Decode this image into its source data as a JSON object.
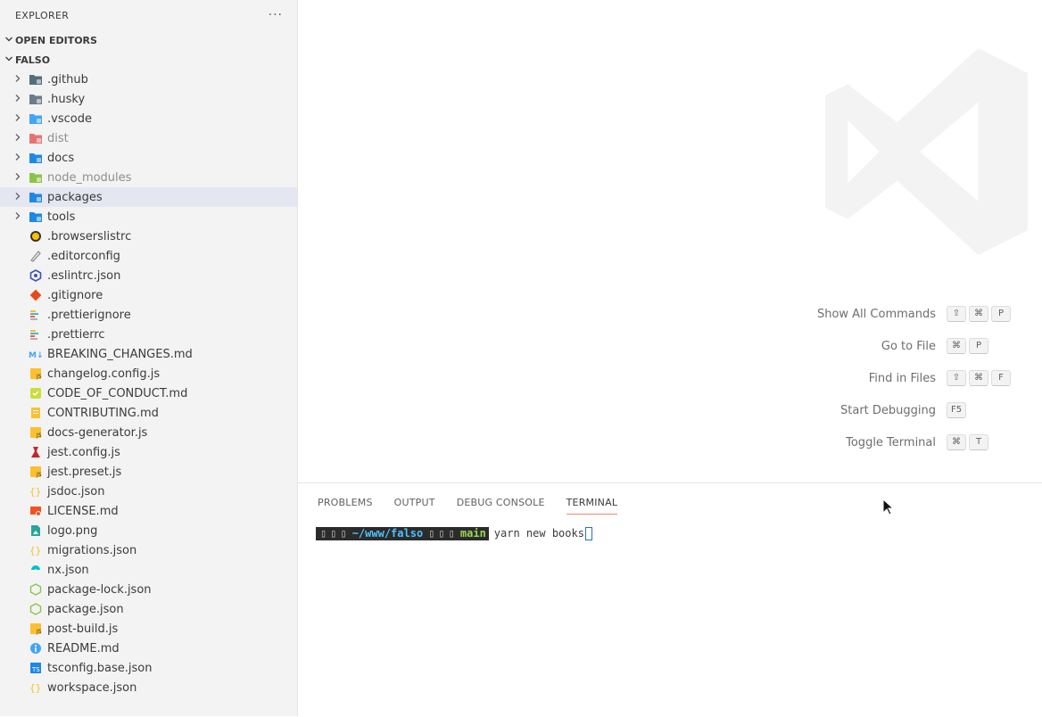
{
  "sidebar": {
    "title": "EXPLORER",
    "more_glyph": "···",
    "sections": {
      "open_editors": "OPEN EDITORS",
      "project": "FALSO"
    },
    "folders": [
      {
        "label": ".github",
        "icon": "folder-github-icon",
        "color": "#546e7a"
      },
      {
        "label": ".husky",
        "icon": "folder-husky-icon",
        "color": "#6b7b8a"
      },
      {
        "label": ".vscode",
        "icon": "folder-vscode-icon",
        "color": "#42a5f5"
      },
      {
        "label": "dist",
        "icon": "folder-dist-icon",
        "color": "#e57373"
      },
      {
        "label": "docs",
        "icon": "folder-docs-icon",
        "color": "#1e88e5"
      },
      {
        "label": "node_modules",
        "icon": "folder-node-icon",
        "color": "#8bc34a"
      },
      {
        "label": "packages",
        "icon": "folder-packages-icon",
        "color": "#1e88e5"
      },
      {
        "label": "tools",
        "icon": "folder-tools-icon",
        "color": "#1e88e5"
      }
    ],
    "files": [
      {
        "label": ".browserslistrc",
        "icon": "browserslist-icon",
        "color": "#f9c000"
      },
      {
        "label": ".editorconfig",
        "icon": "editorconfig-icon",
        "color": "#8a8a8a"
      },
      {
        "label": ".eslintrc.json",
        "icon": "eslint-icon",
        "color": "#3f51b5"
      },
      {
        "label": ".gitignore",
        "icon": "git-icon",
        "color": "#e64a19"
      },
      {
        "label": ".prettierignore",
        "icon": "prettier-icon",
        "color": "#b0b0b0"
      },
      {
        "label": ".prettierrc",
        "icon": "prettier-icon",
        "color": "#b0b0b0"
      },
      {
        "label": "BREAKING_CHANGES.md",
        "icon": "markdown-icon",
        "color": "#42a5f5"
      },
      {
        "label": "changelog.config.js",
        "icon": "javascript-icon",
        "color": "#fbc02d"
      },
      {
        "label": "CODE_OF_CONDUCT.md",
        "icon": "conduct-icon",
        "color": "#cddc39"
      },
      {
        "label": "CONTRIBUTING.md",
        "icon": "contributing-icon",
        "color": "#fbc02d"
      },
      {
        "label": "docs-generator.js",
        "icon": "javascript-icon",
        "color": "#fbc02d"
      },
      {
        "label": "jest.config.js",
        "icon": "jest-icon",
        "color": "#c62828"
      },
      {
        "label": "jest.preset.js",
        "icon": "javascript-icon",
        "color": "#fbc02d"
      },
      {
        "label": "jsdoc.json",
        "icon": "json-icon",
        "color": "#fbc02d"
      },
      {
        "label": "LICENSE.md",
        "icon": "license-icon",
        "color": "#f4511e"
      },
      {
        "label": "logo.png",
        "icon": "image-icon",
        "color": "#26a69a"
      },
      {
        "label": "migrations.json",
        "icon": "json-icon",
        "color": "#fbc02d"
      },
      {
        "label": "nx.json",
        "icon": "nx-icon",
        "color": "#00bcd4"
      },
      {
        "label": "package-lock.json",
        "icon": "nodejs-icon",
        "color": "#8bc34a"
      },
      {
        "label": "package.json",
        "icon": "nodejs-icon",
        "color": "#8bc34a"
      },
      {
        "label": "post-build.js",
        "icon": "javascript-icon",
        "color": "#fbc02d"
      },
      {
        "label": "README.md",
        "icon": "info-icon",
        "color": "#42a5f5"
      },
      {
        "label": "tsconfig.base.json",
        "icon": "tsconfig-icon",
        "color": "#1e88e5"
      },
      {
        "label": "workspace.json",
        "icon": "json-icon",
        "color": "#fbc02d"
      }
    ]
  },
  "editor": {
    "commands": [
      {
        "name": "Show All Commands",
        "keys": [
          "⇧",
          "⌘",
          "P"
        ]
      },
      {
        "name": "Go to File",
        "keys": [
          "⌘",
          "P"
        ]
      },
      {
        "name": "Find in Files",
        "keys": [
          "⇧",
          "⌘",
          "F"
        ]
      },
      {
        "name": "Start Debugging",
        "keys": [
          "F5"
        ]
      },
      {
        "name": "Toggle Terminal",
        "keys": [
          "⌘",
          "T"
        ]
      }
    ]
  },
  "panel": {
    "tabs": [
      "PROBLEMS",
      "OUTPUT",
      "DEBUG CONSOLE",
      "TERMINAL"
    ],
    "active_tab": "TERMINAL",
    "terminal": {
      "path": "~/www/falso",
      "branch": "main",
      "command": "yarn new books"
    }
  }
}
